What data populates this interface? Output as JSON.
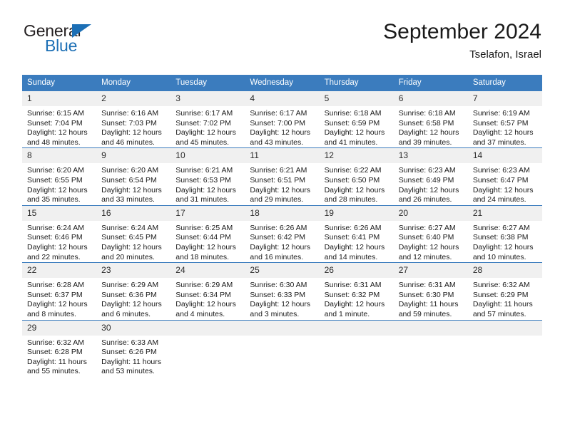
{
  "brand": {
    "name_part1": "General",
    "name_part2": "Blue",
    "accent_color": "#1c6fb5"
  },
  "header": {
    "month_year": "September 2024",
    "location": "Tselafon, Israel"
  },
  "calendar": {
    "header_bg": "#3b7cbe",
    "weekdays": [
      "Sunday",
      "Monday",
      "Tuesday",
      "Wednesday",
      "Thursday",
      "Friday",
      "Saturday"
    ],
    "weeks": [
      [
        {
          "day": "1",
          "sunrise": "Sunrise: 6:15 AM",
          "sunset": "Sunset: 7:04 PM",
          "daylight_1": "Daylight: 12 hours",
          "daylight_2": "and 48 minutes."
        },
        {
          "day": "2",
          "sunrise": "Sunrise: 6:16 AM",
          "sunset": "Sunset: 7:03 PM",
          "daylight_1": "Daylight: 12 hours",
          "daylight_2": "and 46 minutes."
        },
        {
          "day": "3",
          "sunrise": "Sunrise: 6:17 AM",
          "sunset": "Sunset: 7:02 PM",
          "daylight_1": "Daylight: 12 hours",
          "daylight_2": "and 45 minutes."
        },
        {
          "day": "4",
          "sunrise": "Sunrise: 6:17 AM",
          "sunset": "Sunset: 7:00 PM",
          "daylight_1": "Daylight: 12 hours",
          "daylight_2": "and 43 minutes."
        },
        {
          "day": "5",
          "sunrise": "Sunrise: 6:18 AM",
          "sunset": "Sunset: 6:59 PM",
          "daylight_1": "Daylight: 12 hours",
          "daylight_2": "and 41 minutes."
        },
        {
          "day": "6",
          "sunrise": "Sunrise: 6:18 AM",
          "sunset": "Sunset: 6:58 PM",
          "daylight_1": "Daylight: 12 hours",
          "daylight_2": "and 39 minutes."
        },
        {
          "day": "7",
          "sunrise": "Sunrise: 6:19 AM",
          "sunset": "Sunset: 6:57 PM",
          "daylight_1": "Daylight: 12 hours",
          "daylight_2": "and 37 minutes."
        }
      ],
      [
        {
          "day": "8",
          "sunrise": "Sunrise: 6:20 AM",
          "sunset": "Sunset: 6:55 PM",
          "daylight_1": "Daylight: 12 hours",
          "daylight_2": "and 35 minutes."
        },
        {
          "day": "9",
          "sunrise": "Sunrise: 6:20 AM",
          "sunset": "Sunset: 6:54 PM",
          "daylight_1": "Daylight: 12 hours",
          "daylight_2": "and 33 minutes."
        },
        {
          "day": "10",
          "sunrise": "Sunrise: 6:21 AM",
          "sunset": "Sunset: 6:53 PM",
          "daylight_1": "Daylight: 12 hours",
          "daylight_2": "and 31 minutes."
        },
        {
          "day": "11",
          "sunrise": "Sunrise: 6:21 AM",
          "sunset": "Sunset: 6:51 PM",
          "daylight_1": "Daylight: 12 hours",
          "daylight_2": "and 29 minutes."
        },
        {
          "day": "12",
          "sunrise": "Sunrise: 6:22 AM",
          "sunset": "Sunset: 6:50 PM",
          "daylight_1": "Daylight: 12 hours",
          "daylight_2": "and 28 minutes."
        },
        {
          "day": "13",
          "sunrise": "Sunrise: 6:23 AM",
          "sunset": "Sunset: 6:49 PM",
          "daylight_1": "Daylight: 12 hours",
          "daylight_2": "and 26 minutes."
        },
        {
          "day": "14",
          "sunrise": "Sunrise: 6:23 AM",
          "sunset": "Sunset: 6:47 PM",
          "daylight_1": "Daylight: 12 hours",
          "daylight_2": "and 24 minutes."
        }
      ],
      [
        {
          "day": "15",
          "sunrise": "Sunrise: 6:24 AM",
          "sunset": "Sunset: 6:46 PM",
          "daylight_1": "Daylight: 12 hours",
          "daylight_2": "and 22 minutes."
        },
        {
          "day": "16",
          "sunrise": "Sunrise: 6:24 AM",
          "sunset": "Sunset: 6:45 PM",
          "daylight_1": "Daylight: 12 hours",
          "daylight_2": "and 20 minutes."
        },
        {
          "day": "17",
          "sunrise": "Sunrise: 6:25 AM",
          "sunset": "Sunset: 6:44 PM",
          "daylight_1": "Daylight: 12 hours",
          "daylight_2": "and 18 minutes."
        },
        {
          "day": "18",
          "sunrise": "Sunrise: 6:26 AM",
          "sunset": "Sunset: 6:42 PM",
          "daylight_1": "Daylight: 12 hours",
          "daylight_2": "and 16 minutes."
        },
        {
          "day": "19",
          "sunrise": "Sunrise: 6:26 AM",
          "sunset": "Sunset: 6:41 PM",
          "daylight_1": "Daylight: 12 hours",
          "daylight_2": "and 14 minutes."
        },
        {
          "day": "20",
          "sunrise": "Sunrise: 6:27 AM",
          "sunset": "Sunset: 6:40 PM",
          "daylight_1": "Daylight: 12 hours",
          "daylight_2": "and 12 minutes."
        },
        {
          "day": "21",
          "sunrise": "Sunrise: 6:27 AM",
          "sunset": "Sunset: 6:38 PM",
          "daylight_1": "Daylight: 12 hours",
          "daylight_2": "and 10 minutes."
        }
      ],
      [
        {
          "day": "22",
          "sunrise": "Sunrise: 6:28 AM",
          "sunset": "Sunset: 6:37 PM",
          "daylight_1": "Daylight: 12 hours",
          "daylight_2": "and 8 minutes."
        },
        {
          "day": "23",
          "sunrise": "Sunrise: 6:29 AM",
          "sunset": "Sunset: 6:36 PM",
          "daylight_1": "Daylight: 12 hours",
          "daylight_2": "and 6 minutes."
        },
        {
          "day": "24",
          "sunrise": "Sunrise: 6:29 AM",
          "sunset": "Sunset: 6:34 PM",
          "daylight_1": "Daylight: 12 hours",
          "daylight_2": "and 4 minutes."
        },
        {
          "day": "25",
          "sunrise": "Sunrise: 6:30 AM",
          "sunset": "Sunset: 6:33 PM",
          "daylight_1": "Daylight: 12 hours",
          "daylight_2": "and 3 minutes."
        },
        {
          "day": "26",
          "sunrise": "Sunrise: 6:31 AM",
          "sunset": "Sunset: 6:32 PM",
          "daylight_1": "Daylight: 12 hours",
          "daylight_2": "and 1 minute."
        },
        {
          "day": "27",
          "sunrise": "Sunrise: 6:31 AM",
          "sunset": "Sunset: 6:30 PM",
          "daylight_1": "Daylight: 11 hours",
          "daylight_2": "and 59 minutes."
        },
        {
          "day": "28",
          "sunrise": "Sunrise: 6:32 AM",
          "sunset": "Sunset: 6:29 PM",
          "daylight_1": "Daylight: 11 hours",
          "daylight_2": "and 57 minutes."
        }
      ],
      [
        {
          "day": "29",
          "sunrise": "Sunrise: 6:32 AM",
          "sunset": "Sunset: 6:28 PM",
          "daylight_1": "Daylight: 11 hours",
          "daylight_2": "and 55 minutes."
        },
        {
          "day": "30",
          "sunrise": "Sunrise: 6:33 AM",
          "sunset": "Sunset: 6:26 PM",
          "daylight_1": "Daylight: 11 hours",
          "daylight_2": "and 53 minutes."
        },
        {
          "day": "",
          "sunrise": "",
          "sunset": "",
          "daylight_1": "",
          "daylight_2": ""
        },
        {
          "day": "",
          "sunrise": "",
          "sunset": "",
          "daylight_1": "",
          "daylight_2": ""
        },
        {
          "day": "",
          "sunrise": "",
          "sunset": "",
          "daylight_1": "",
          "daylight_2": ""
        },
        {
          "day": "",
          "sunrise": "",
          "sunset": "",
          "daylight_1": "",
          "daylight_2": ""
        },
        {
          "day": "",
          "sunrise": "",
          "sunset": "",
          "daylight_1": "",
          "daylight_2": ""
        }
      ]
    ]
  }
}
